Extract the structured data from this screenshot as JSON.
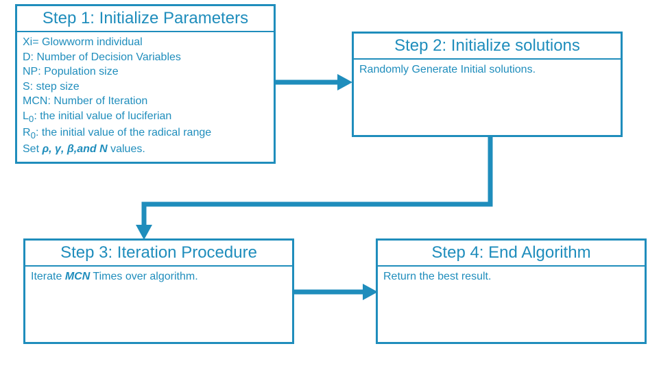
{
  "step1": {
    "title": "Step 1: Initialize Parameters",
    "lines": [
      "Xi= Glowworm individual",
      "D: Number of Decision Variables",
      "NP: Population size",
      "S: step size",
      "MCN: Number of Iteration",
      "L0: the initial value of luciferian",
      "R0: the initial value of the radical range"
    ],
    "setLinePrefix": "Set ",
    "setLineGreek": "ρ, γ, β,and N",
    "setLineSuffix": "  values."
  },
  "step2": {
    "title": "Step 2: Initialize solutions",
    "content": "Randomly Generate Initial solutions."
  },
  "step3": {
    "title": "Step 3: Iteration Procedure",
    "contentPrefix": "Iterate ",
    "contentItalic": "MCN",
    "contentSuffix": " Times over algorithm."
  },
  "step4": {
    "title": "Step 4: End Algorithm",
    "content": "Return the best result."
  },
  "colors": {
    "primary": "#1F8DBC"
  }
}
